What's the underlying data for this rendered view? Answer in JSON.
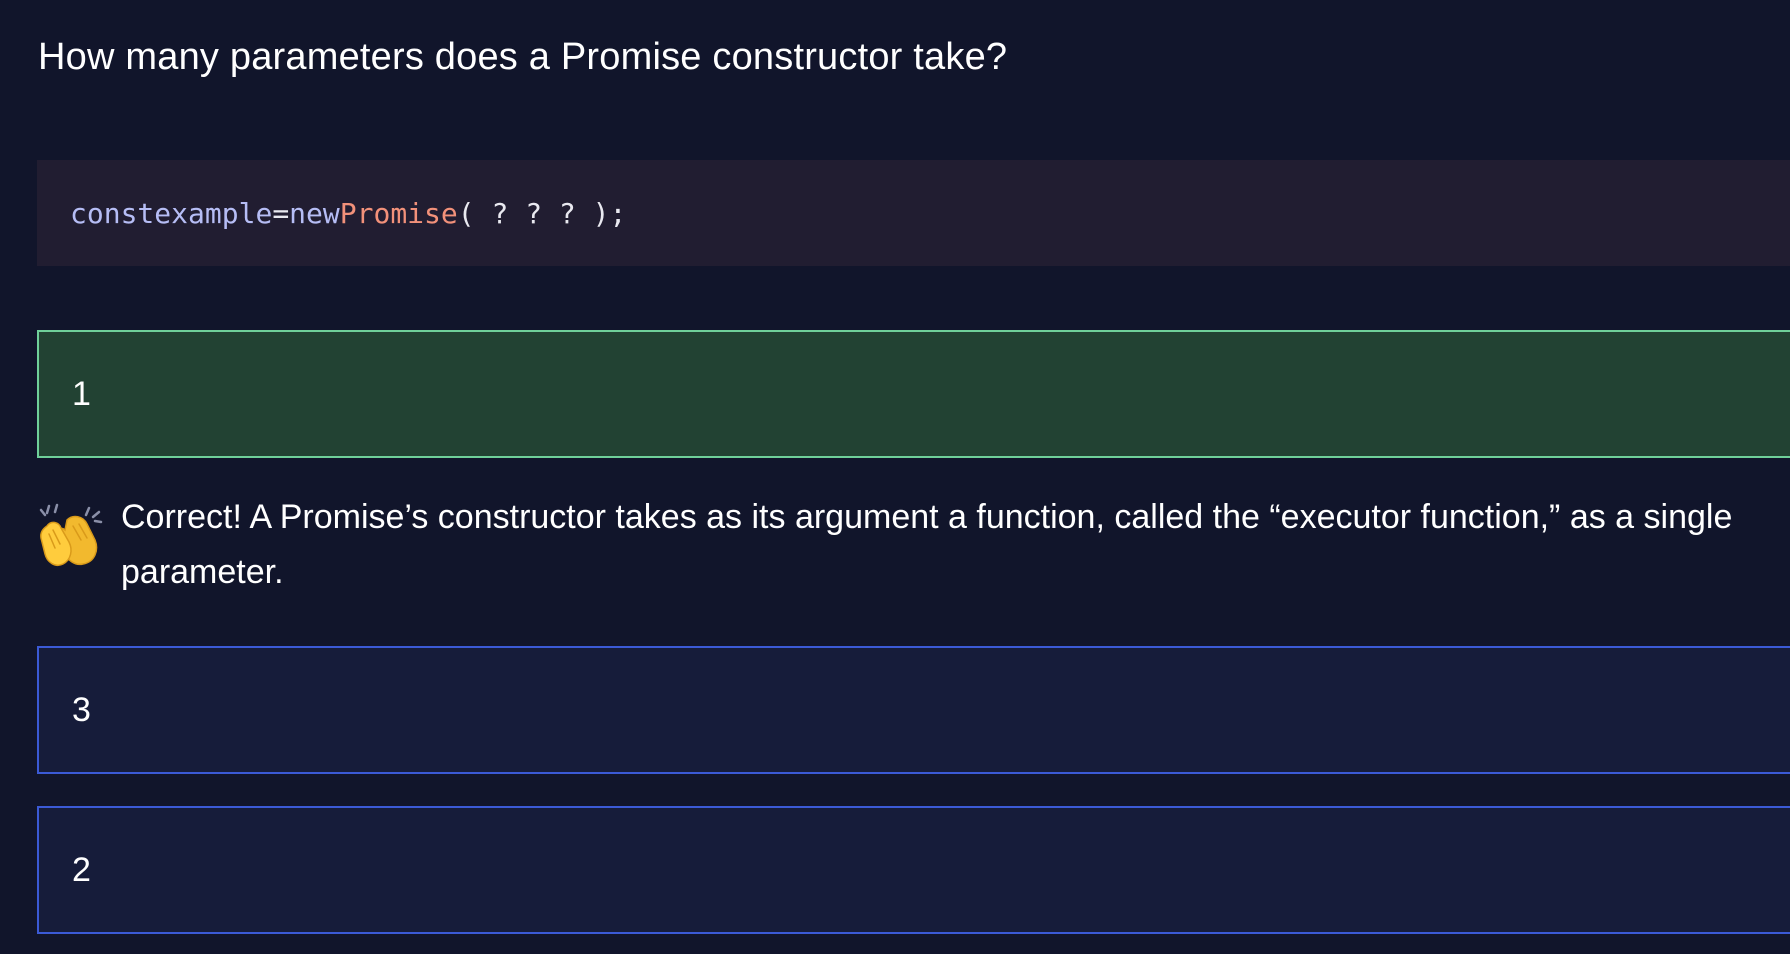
{
  "question": {
    "title": "How many parameters does a Promise constructor take?"
  },
  "code": {
    "keyword_const": "const",
    "identifier": "example",
    "operator": "=",
    "keyword_new": "new",
    "class_name": "Promise",
    "args": "( ? ? ? );"
  },
  "answers": [
    {
      "label": "1",
      "state": "correct"
    },
    {
      "label": "3",
      "state": "unselected"
    },
    {
      "label": "2",
      "state": "unselected"
    }
  ],
  "feedback": {
    "icon": "clapping-hands-icon",
    "text": "Correct! A Promise’s constructor takes as its argument a function, called the “executor function,” as a single parameter."
  },
  "colors": {
    "background": "#11152b",
    "code_background": "#211d31",
    "correct_background": "#224233",
    "correct_border": "#6fd09a",
    "option_border": "#3b5ad6",
    "option_background": "#161c3a",
    "code_class_color": "#f2917a",
    "code_keyword_color": "#b6bdf5"
  }
}
